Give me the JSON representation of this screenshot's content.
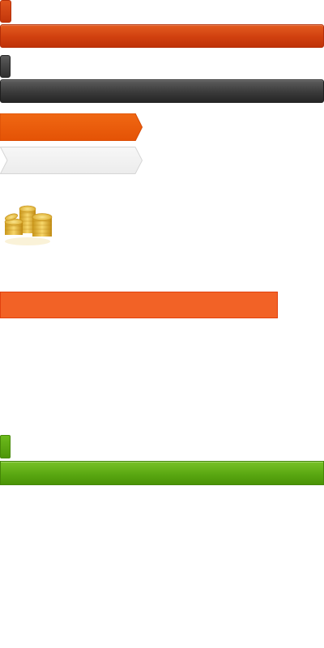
{
  "sprite_rows": {
    "red": {
      "color": "#d0400f"
    },
    "dark": {
      "color": "#3a3a3a"
    },
    "green": {
      "color": "#5aa812"
    }
  },
  "step_arrows": [
    {
      "state": "active",
      "color": "#ec5a0c"
    },
    {
      "state": "inactive",
      "color": "#f2f2f2"
    }
  ],
  "coins_icon": "coin-stack-icon",
  "flat_button": {
    "color": "#f26226"
  }
}
